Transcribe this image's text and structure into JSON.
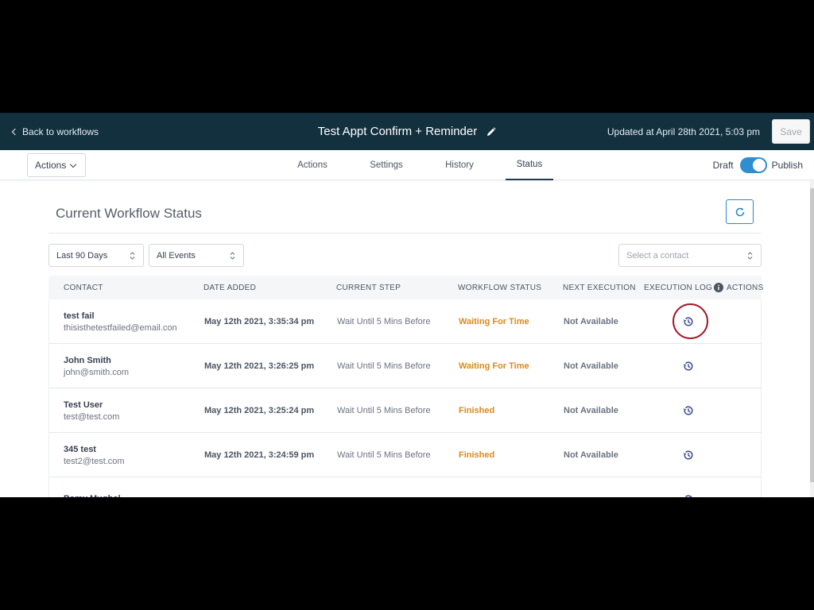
{
  "header": {
    "back_label": "Back to workflows",
    "title": "Test Appt Confirm + Reminder",
    "updated": "Updated at April 28th 2021, 5:03 pm",
    "save_label": "Save"
  },
  "toolbar": {
    "actions_label": "Actions",
    "tabs": [
      {
        "label": "Actions",
        "active": false
      },
      {
        "label": "Settings",
        "active": false
      },
      {
        "label": "History",
        "active": false
      },
      {
        "label": "Status",
        "active": true
      }
    ],
    "draft_label": "Draft",
    "publish_label": "Publish",
    "toggle_color": "#2e8fd0"
  },
  "main": {
    "section_title": "Current Workflow Status",
    "filters": {
      "date_range": "Last 90 Days",
      "events": "All Events",
      "contact_placeholder": "Select a contact"
    },
    "columns": {
      "contact": "CONTACT",
      "date_added": "DATE ADDED",
      "current_step": "CURRENT STEP",
      "workflow_status": "WORKFLOW STATUS",
      "next_execution": "NEXT EXECUTION",
      "execution_log": "EXECUTION LOG",
      "actions": "ACTIONS"
    },
    "rows": [
      {
        "name": "test fail",
        "email": "thisisthetestfailed@email.con",
        "date": "May 12th 2021, 3:35:34 pm",
        "step": "Wait Until 5 Mins Before",
        "status": "Waiting For Time",
        "next": "Not Available"
      },
      {
        "name": "John Smith",
        "email": "john@smith.com",
        "date": "May 12th 2021, 3:26:25 pm",
        "step": "Wait Until 5 Mins Before",
        "status": "Waiting For Time",
        "next": "Not Available"
      },
      {
        "name": "Test User",
        "email": "test@test.com",
        "date": "May 12th 2021, 3:25:24 pm",
        "step": "Wait Until 5 Mins Before",
        "status": "Finished",
        "next": "Not Available"
      },
      {
        "name": "345 test",
        "email": "test2@test.com",
        "date": "May 12th 2021, 3:24:59 pm",
        "step": "Wait Until 5 Mins Before",
        "status": "Finished",
        "next": "Not Available"
      },
      {
        "name": "Pomy Mughal",
        "email": "",
        "date": "",
        "step": "",
        "status": "",
        "next": ""
      }
    ],
    "status_color": "#d98a1e",
    "accent_color": "#2a89c6"
  }
}
